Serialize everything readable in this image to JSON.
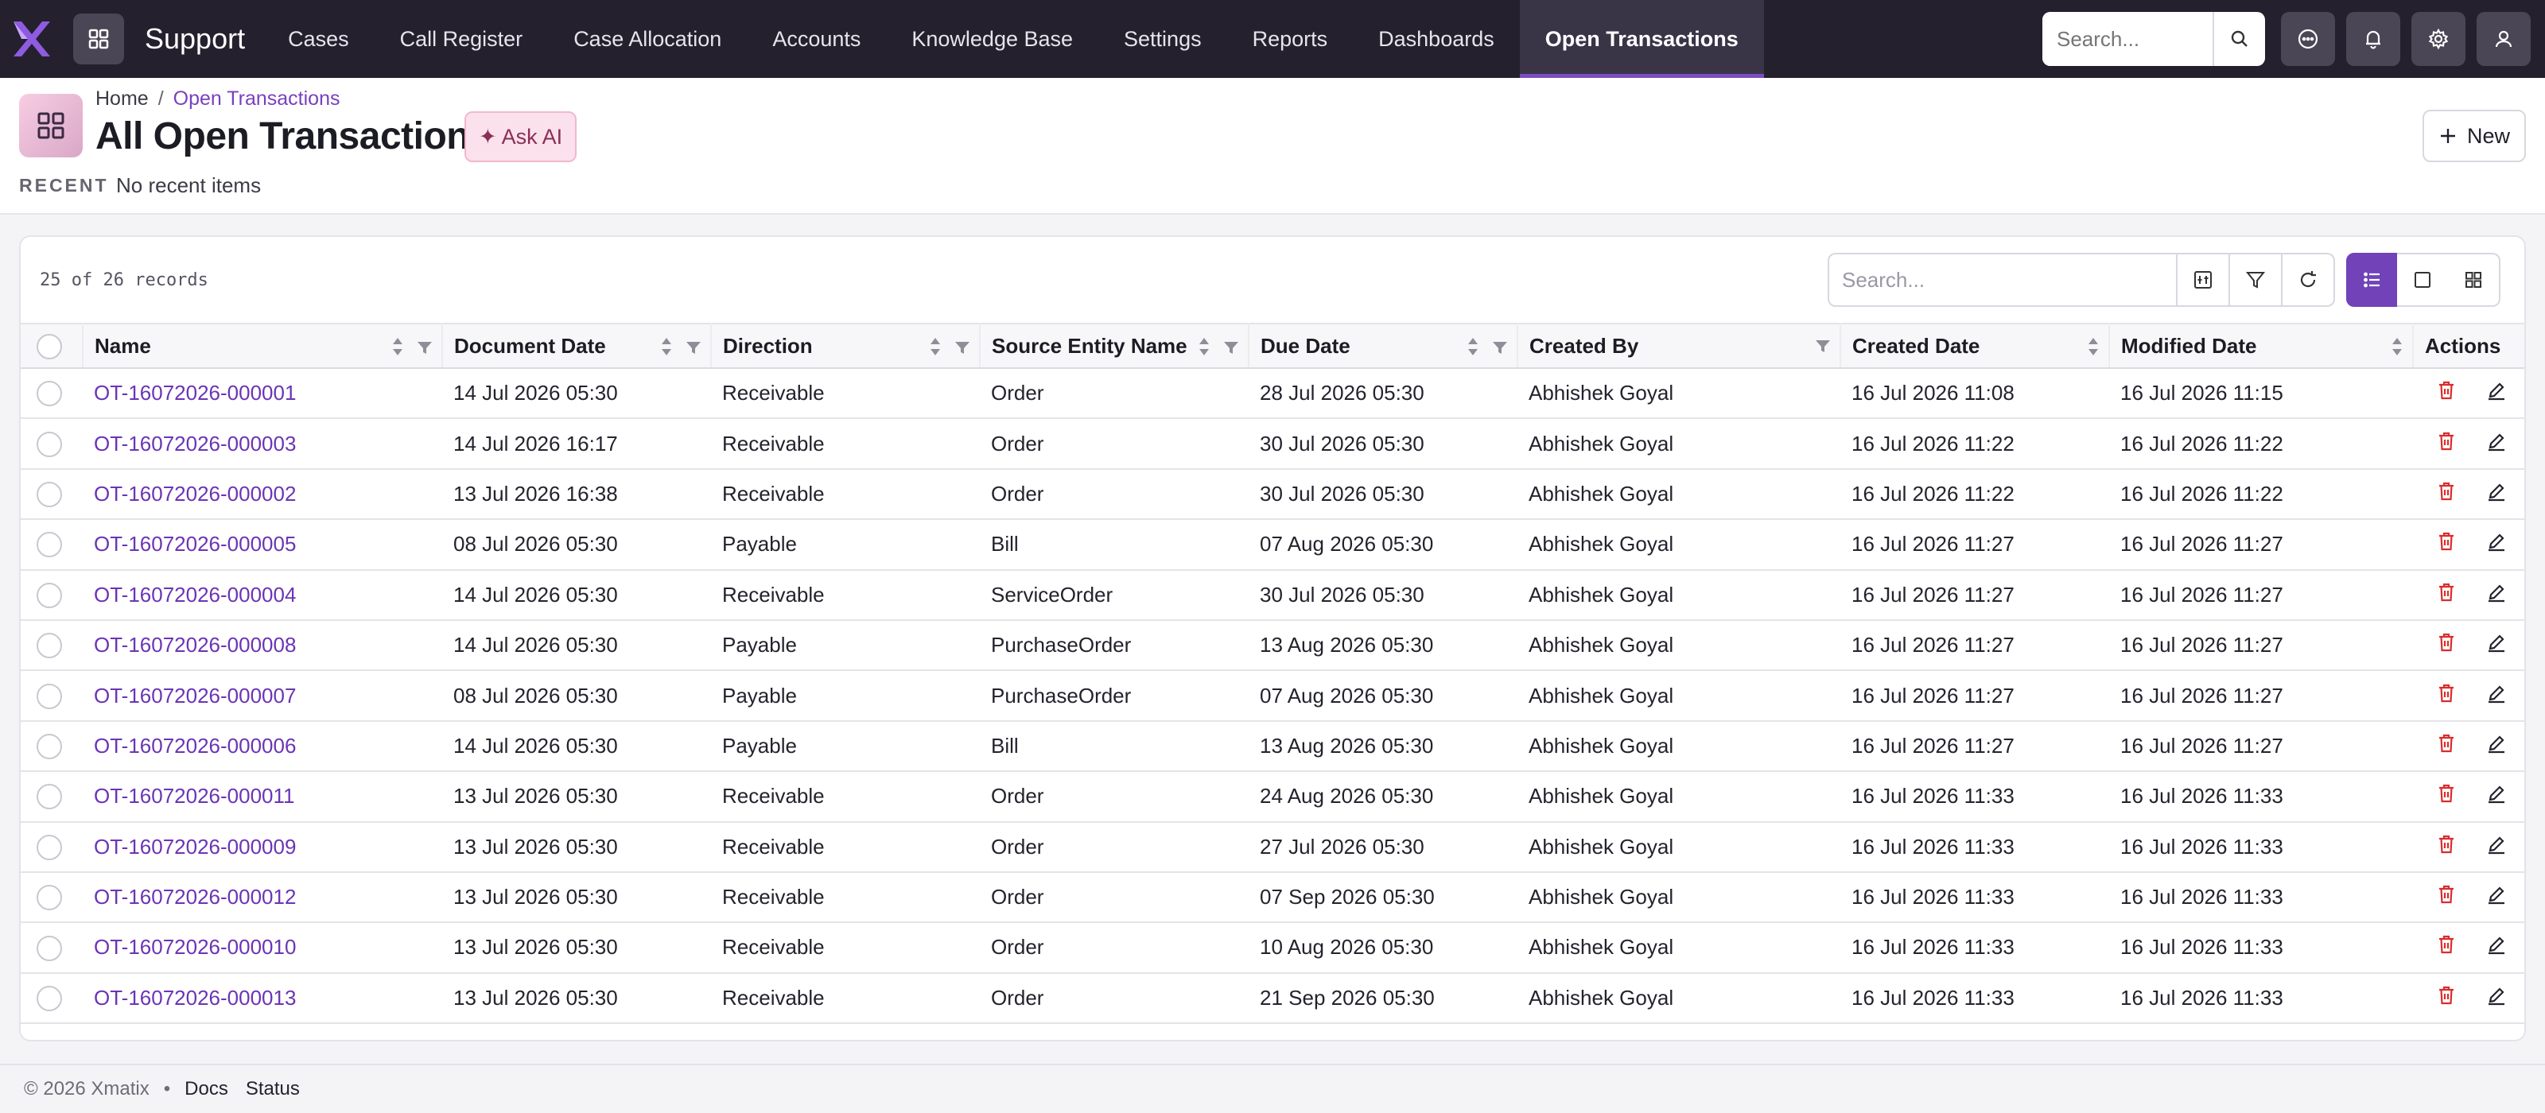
{
  "app": {
    "name": "Support",
    "brand_color": "#7b4cc4",
    "nav": [
      {
        "label": "Cases"
      },
      {
        "label": "Call Register"
      },
      {
        "label": "Case Allocation"
      },
      {
        "label": "Accounts"
      },
      {
        "label": "Knowledge Base"
      },
      {
        "label": "Settings"
      },
      {
        "label": "Reports"
      },
      {
        "label": "Dashboards"
      },
      {
        "label": "Open Transactions",
        "active": true
      }
    ],
    "search_placeholder": "Search..."
  },
  "header": {
    "breadcrumb": [
      "Home",
      "Open Transactions"
    ],
    "breadcrumb_sep": "/",
    "title": "All Open Transaction",
    "ask_ai": "Ask AI",
    "recent_label": "RECENT",
    "recent_value": "No recent items",
    "new_label": "New"
  },
  "list": {
    "records_text": "25 of 26 records",
    "search_placeholder": "Search...",
    "columns": [
      "Name",
      "Document Date",
      "Direction",
      "Source Entity Name",
      "Due Date",
      "Created By",
      "Created Date",
      "Modified Date",
      "Actions"
    ],
    "rows": [
      [
        "OT-16072026-000001",
        "14 Jul 2026 05:30",
        "Receivable",
        "Order",
        "28 Jul 2026 05:30",
        "Abhishek Goyal",
        "16 Jul 2026 11:08",
        "16 Jul 2026 11:15"
      ],
      [
        "OT-16072026-000003",
        "14 Jul 2026 16:17",
        "Receivable",
        "Order",
        "30 Jul 2026 05:30",
        "Abhishek Goyal",
        "16 Jul 2026 11:22",
        "16 Jul 2026 11:22"
      ],
      [
        "OT-16072026-000002",
        "13 Jul 2026 16:38",
        "Receivable",
        "Order",
        "30 Jul 2026 05:30",
        "Abhishek Goyal",
        "16 Jul 2026 11:22",
        "16 Jul 2026 11:22"
      ],
      [
        "OT-16072026-000005",
        "08 Jul 2026 05:30",
        "Payable",
        "Bill",
        "07 Aug 2026 05:30",
        "Abhishek Goyal",
        "16 Jul 2026 11:27",
        "16 Jul 2026 11:27"
      ],
      [
        "OT-16072026-000004",
        "14 Jul 2026 05:30",
        "Receivable",
        "ServiceOrder",
        "30 Jul 2026 05:30",
        "Abhishek Goyal",
        "16 Jul 2026 11:27",
        "16 Jul 2026 11:27"
      ],
      [
        "OT-16072026-000008",
        "14 Jul 2026 05:30",
        "Payable",
        "PurchaseOrder",
        "13 Aug 2026 05:30",
        "Abhishek Goyal",
        "16 Jul 2026 11:27",
        "16 Jul 2026 11:27"
      ],
      [
        "OT-16072026-000007",
        "08 Jul 2026 05:30",
        "Payable",
        "PurchaseOrder",
        "07 Aug 2026 05:30",
        "Abhishek Goyal",
        "16 Jul 2026 11:27",
        "16 Jul 2026 11:27"
      ],
      [
        "OT-16072026-000006",
        "14 Jul 2026 05:30",
        "Payable",
        "Bill",
        "13 Aug 2026 05:30",
        "Abhishek Goyal",
        "16 Jul 2026 11:27",
        "16 Jul 2026 11:27"
      ],
      [
        "OT-16072026-000011",
        "13 Jul 2026 05:30",
        "Receivable",
        "Order",
        "24 Aug 2026 05:30",
        "Abhishek Goyal",
        "16 Jul 2026 11:33",
        "16 Jul 2026 11:33"
      ],
      [
        "OT-16072026-000009",
        "13 Jul 2026 05:30",
        "Receivable",
        "Order",
        "27 Jul 2026 05:30",
        "Abhishek Goyal",
        "16 Jul 2026 11:33",
        "16 Jul 2026 11:33"
      ],
      [
        "OT-16072026-000012",
        "13 Jul 2026 05:30",
        "Receivable",
        "Order",
        "07 Sep 2026 05:30",
        "Abhishek Goyal",
        "16 Jul 2026 11:33",
        "16 Jul 2026 11:33"
      ],
      [
        "OT-16072026-000010",
        "13 Jul 2026 05:30",
        "Receivable",
        "Order",
        "10 Aug 2026 05:30",
        "Abhishek Goyal",
        "16 Jul 2026 11:33",
        "16 Jul 2026 11:33"
      ],
      [
        "OT-16072026-000013",
        "13 Jul 2026 05:30",
        "Receivable",
        "Order",
        "21 Sep 2026 05:30",
        "Abhishek Goyal",
        "16 Jul 2026 11:33",
        "16 Jul 2026 11:33"
      ]
    ]
  },
  "footer": {
    "copyright": "© 2026 Xmatix",
    "sep": "•",
    "links": [
      "Docs",
      "Status"
    ]
  },
  "icons": {
    "logo": "xmatix-logo-icon",
    "apps": "apps-grid-icon",
    "search": "search-icon",
    "chat": "chat-icon",
    "bell": "bell-icon",
    "gear": "gear-icon",
    "user": "user-icon",
    "delete": "trash-icon",
    "edit": "pencil-icon"
  }
}
